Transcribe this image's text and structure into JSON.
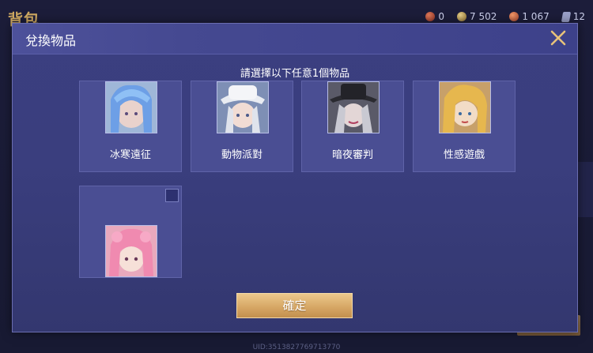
{
  "background": {
    "title": "背包",
    "resources": [
      {
        "icon": "ruby-coin-icon",
        "value": "0"
      },
      {
        "icon": "gold-coin-icon",
        "value": "7 502"
      },
      {
        "icon": "voucher-coin-icon",
        "value": "1 067"
      },
      {
        "icon": "card-icon",
        "value": "12"
      }
    ],
    "uid": "UID:3513827769713770"
  },
  "dialog": {
    "title": "兌換物品",
    "close_icon": "close-x-icon",
    "instruction": "請選擇以下任意1個物品",
    "items": [
      {
        "name": "冰寒遠征",
        "portrait": "blue-haired-hero-portrait"
      },
      {
        "name": "動物派對",
        "portrait": "white-hat-hero-portrait"
      },
      {
        "name": "暗夜審判",
        "portrait": "dark-hat-hero-portrait"
      },
      {
        "name": "性感遊戲",
        "portrait": "blonde-hero-portrait"
      },
      {
        "name": "",
        "portrait": "pink-haired-hero-portrait"
      }
    ],
    "confirm_label": "確定"
  },
  "colors": {
    "dialog_bg": "#3b3f80",
    "tile_bg": "#4a4e93",
    "confirm_gold": "#d7a866",
    "close_gold": "#e8c27a"
  }
}
